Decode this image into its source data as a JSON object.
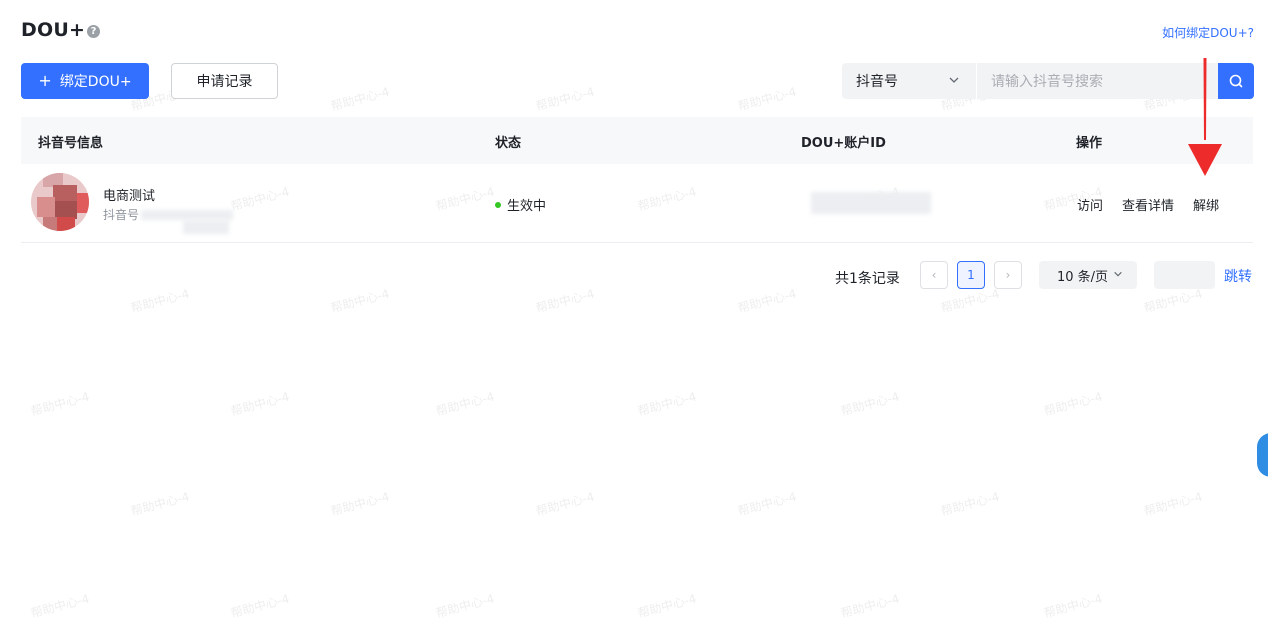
{
  "header": {
    "title": "DOU+",
    "help_glyph": "?",
    "how_to_bind_link": "如何绑定DOU+?"
  },
  "toolbar": {
    "bind_button_label": "绑定DOU+",
    "bind_button_glyph": "+",
    "records_button_label": "申请记录",
    "search_type_selected": "抖音号",
    "search_placeholder": "请输入抖音号搜索"
  },
  "table": {
    "columns": [
      "抖音号信息",
      "状态",
      "DOU+账户ID",
      "操作"
    ],
    "rows": [
      {
        "name": "电商测试",
        "douyin_id_prefix": "抖音号",
        "status": "生效中",
        "actions": [
          "访问",
          "查看详情",
          "解绑"
        ]
      }
    ]
  },
  "pagination": {
    "total_text": "共1条记录",
    "current_page": "1",
    "prev_glyph": "‹",
    "next_glyph": "›",
    "page_size": "10 条/页",
    "jump_label": "跳转"
  },
  "watermark": "帮助中心-4",
  "colors": {
    "primary": "#3370ff",
    "status_active": "#34c724",
    "annotation_arrow": "#ee2b2b"
  }
}
